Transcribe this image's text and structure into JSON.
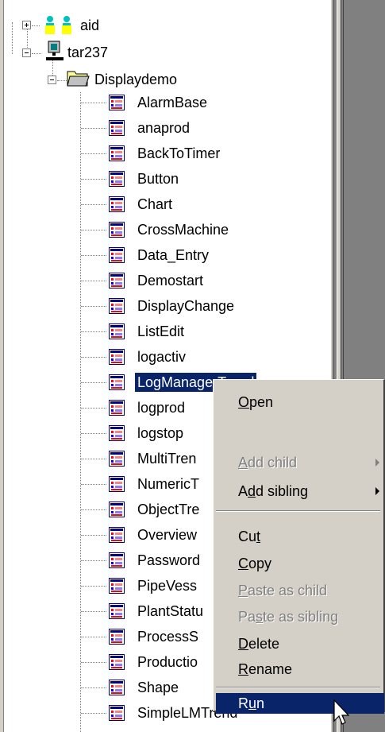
{
  "tree": {
    "root1": {
      "label": "aid",
      "icon": "users-icon"
    },
    "root2": {
      "label": "tar237",
      "icon": "computer-icon"
    },
    "folder": {
      "label": "Displaydemo",
      "icon": "folder-open-icon"
    },
    "items": [
      "AlarmBase",
      "anaprod",
      "BackToTimer",
      "Button",
      "Chart",
      "CrossMachine",
      "Data_Entry",
      "Demostart",
      "DisplayChange",
      "ListEdit",
      "logactiv",
      "LogManagerTrend",
      "logprod",
      "logstop",
      "MultiTrend",
      "NumericT",
      "ObjectTre",
      "Overview",
      "Password",
      "PipeVessel",
      "PlantStatu",
      "ProcessS",
      "Productio",
      "Shape",
      "SimpleLMTrend"
    ],
    "visible_labels": [
      "AlarmBase",
      "anaprod",
      "BackToTimer",
      "Button",
      "Chart",
      "CrossMachine",
      "Data_Entry",
      "Demostart",
      "DisplayChange",
      "ListEdit",
      "logactiv",
      "LogManagerTrend",
      "logprod",
      "logstop",
      "MultiTren",
      "NumericT",
      "ObjectTre",
      "Overview",
      "Password",
      "PipeVess",
      "PlantStatu",
      "ProcessS",
      "Productio",
      "Shape",
      "SimpleLMTrend"
    ],
    "selected_index": 11
  },
  "menu": {
    "open": {
      "pre": "",
      "u": "O",
      "post": "pen"
    },
    "add_child": {
      "pre": "",
      "u": "A",
      "post": "dd child"
    },
    "add_sibling": {
      "pre": "A",
      "u": "d",
      "post": "d sibling"
    },
    "cut": {
      "pre": "Cu",
      "u": "t",
      "post": ""
    },
    "copy": {
      "pre": "",
      "u": "C",
      "post": "opy"
    },
    "paste_child": {
      "pre": "",
      "u": "P",
      "post": "aste as child"
    },
    "paste_sibling": {
      "pre": "Pa",
      "u": "s",
      "post": "te as sibling"
    },
    "delete": {
      "pre": "",
      "u": "D",
      "post": "elete"
    },
    "rename": {
      "pre": "",
      "u": "R",
      "post": "ename"
    },
    "run": {
      "pre": "R",
      "u": "u",
      "post": "n"
    }
  },
  "colors": {
    "selection": "#0a246a",
    "menu_bg": "#d4d0c8"
  }
}
